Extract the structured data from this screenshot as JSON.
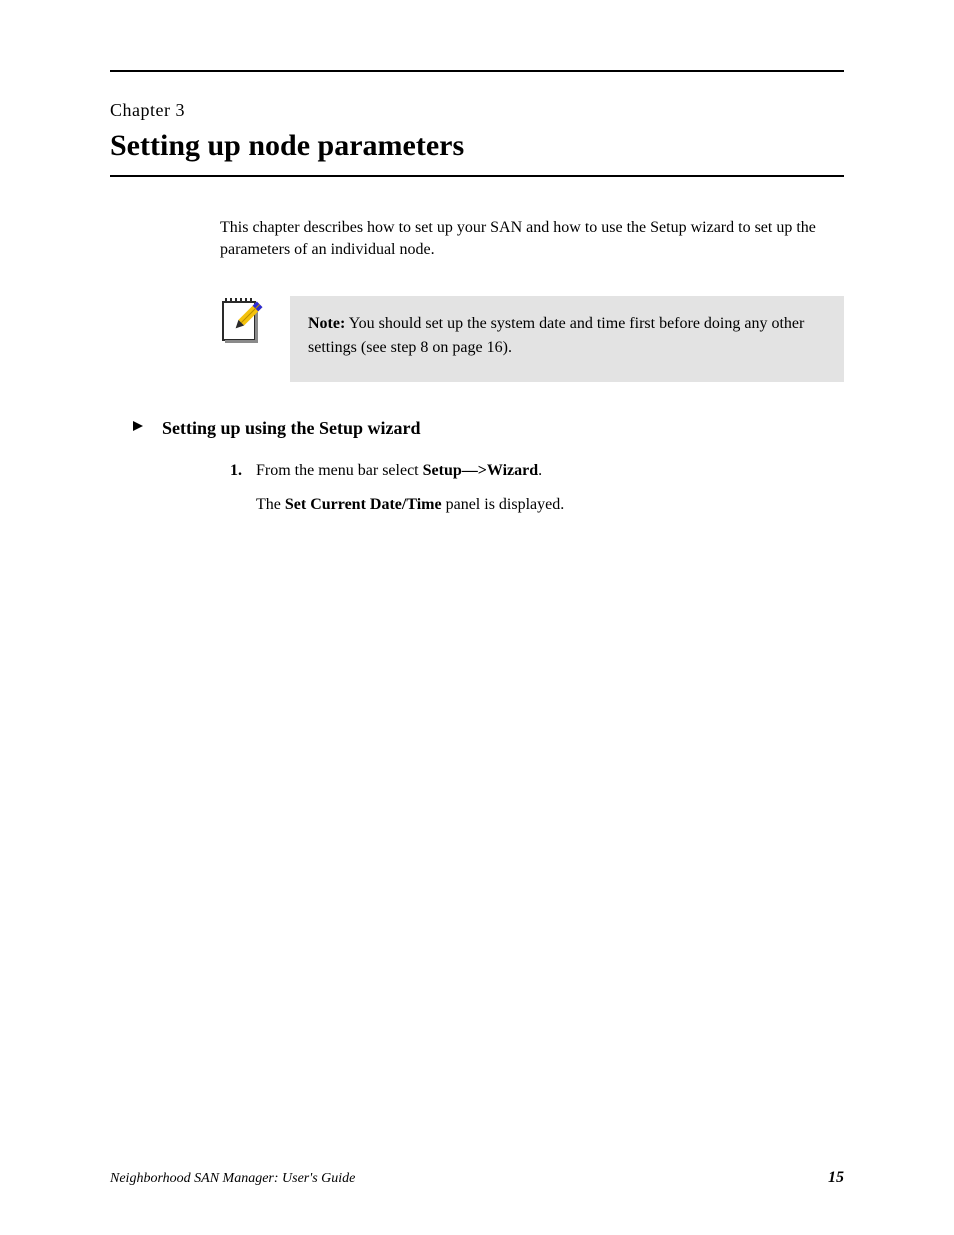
{
  "chapter": {
    "label": "Chapter 3",
    "title": "Setting up node parameters"
  },
  "intro": "This chapter describes how to set up your SAN and how to use the Setup wizard to set up the parameters of an individual node.",
  "note": {
    "label": "Note:",
    "text": "You should set up the system date and time first before doing any other settings (see step 8 on page 16)."
  },
  "section_heading": "Setting up using the Setup wizard",
  "steps": [
    {
      "num": "1.",
      "text_before": "From the menu bar select ",
      "menu": "Setup—>Wizard",
      "text_after": ".",
      "result_before": "The ",
      "result_label": "Set Current Date/Time",
      "result_after": " panel is displayed."
    }
  ],
  "footer": {
    "left": "Neighborhood SAN Manager: User's Guide",
    "right_num": "15"
  }
}
